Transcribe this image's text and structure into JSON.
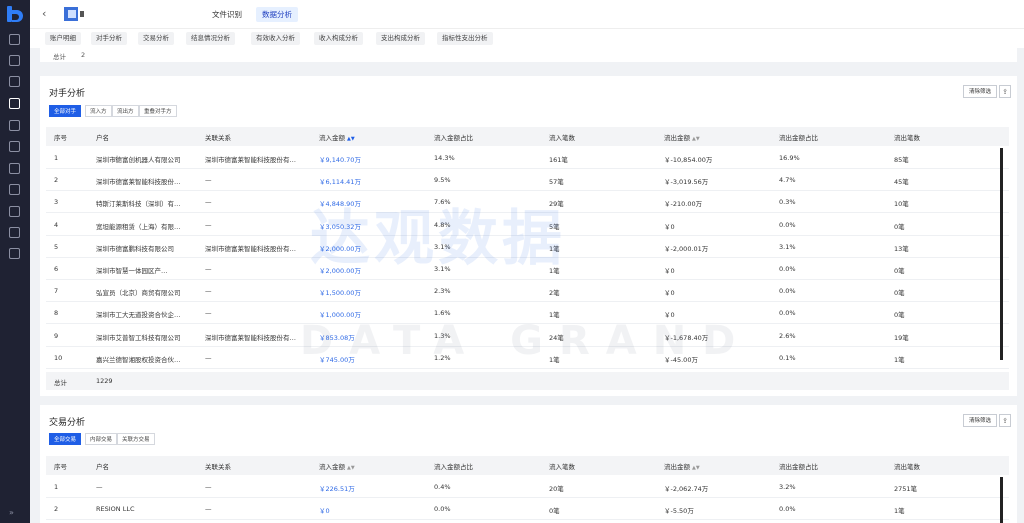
{
  "header": {
    "back": "‹",
    "tabs": [
      {
        "label": "文件识别",
        "active": false
      },
      {
        "label": "数据分析",
        "active": true
      }
    ]
  },
  "subnav": [
    "账户明细",
    "对手分析",
    "交易分析",
    "结息情况分析",
    "有效收入分析",
    "收入构成分析",
    "支出构成分析",
    "指标性支出分析"
  ],
  "summary_top": {
    "label": "总计",
    "value": "2"
  },
  "counterparty": {
    "title": "对手分析",
    "filters": [
      "全部对手",
      "流入方",
      "流出方",
      "重叠对手方"
    ],
    "clear": "清除筛选",
    "columns": [
      "序号",
      "户名",
      "关联关系",
      "流入金额",
      "流入金额占比",
      "流入笔数",
      "流出金额",
      "流出金额占比",
      "流出笔数"
    ],
    "rows": [
      [
        "1",
        "深圳市德富创机器人有限公司",
        "深圳市德富莱智能科技股份有…",
        "￥9,140.70万",
        "14.3%",
        "161笔",
        "￥-10,854.00万",
        "16.9%",
        "85笔"
      ],
      [
        "2",
        "深圳市德富莱智能科技股份…",
        "—",
        "￥6,114.41万",
        "9.5%",
        "57笔",
        "￥-3,019.56万",
        "4.7%",
        "45笔"
      ],
      [
        "3",
        "特斯汀莱斯科技（深圳）有…",
        "—",
        "￥4,848.90万",
        "7.6%",
        "29笔",
        "￥-210.00万",
        "0.3%",
        "10笔"
      ],
      [
        "4",
        "宽坦能源租赁（上海）有限…",
        "—",
        "￥3,050.32万",
        "4.8%",
        "5笔",
        "￥0",
        "0.0%",
        "0笔"
      ],
      [
        "5",
        "深圳市德富鹏科技有限公司",
        "深圳市德富莱智能科技股份有…",
        "￥2,000.00万",
        "3.1%",
        "1笔",
        "￥-2,000.01万",
        "3.1%",
        "13笔"
      ],
      [
        "6",
        "深圳市智慧一体园区产…",
        "—",
        "￥2,000.00万",
        "3.1%",
        "1笔",
        "￥0",
        "0.0%",
        "0笔"
      ],
      [
        "7",
        "弘宣员（北京）商贸有限公司",
        "—",
        "￥1,500.00万",
        "2.3%",
        "2笔",
        "￥0",
        "0.0%",
        "0笔"
      ],
      [
        "8",
        "深圳市工大无道投资合伙企…",
        "—",
        "￥1,000.00万",
        "1.6%",
        "1笔",
        "￥0",
        "0.0%",
        "0笔"
      ],
      [
        "9",
        "深圳市艾普智工科技有限公司",
        "深圳市德富莱智能科技股份有…",
        "￥853.08万",
        "1.3%",
        "24笔",
        "￥-1,678.40万",
        "2.6%",
        "19笔"
      ],
      [
        "10",
        "嘉兴兰德智湘股权投资合伙…",
        "—",
        "￥745.00万",
        "1.2%",
        "1笔",
        "￥-45.00万",
        "0.1%",
        "1笔"
      ]
    ],
    "total_label": "总计",
    "total_value": "1229"
  },
  "transaction": {
    "title": "交易分析",
    "filters": [
      "全部交易",
      "内部交易",
      "关联方交易"
    ],
    "clear": "清除筛选",
    "columns": [
      "序号",
      "户名",
      "关联关系",
      "流入金额",
      "流入金额占比",
      "流入笔数",
      "流出金额",
      "流出金额占比",
      "流出笔数"
    ],
    "rows": [
      [
        "1",
        "—",
        "—",
        "￥226.51万",
        "0.4%",
        "20笔",
        "￥-2,062.74万",
        "3.2%",
        "2751笔"
      ],
      [
        "2",
        "RESION LLC",
        "—",
        "￥0",
        "0.0%",
        "0笔",
        "￥-5.50万",
        "0.0%",
        "1笔"
      ]
    ]
  },
  "watermark": {
    "cn": "达观数据",
    "en": "DATA GRAND"
  },
  "colors": {
    "accent": "#1f5ee6",
    "link": "#2f6ae6",
    "sidebar": "#1f2233"
  }
}
